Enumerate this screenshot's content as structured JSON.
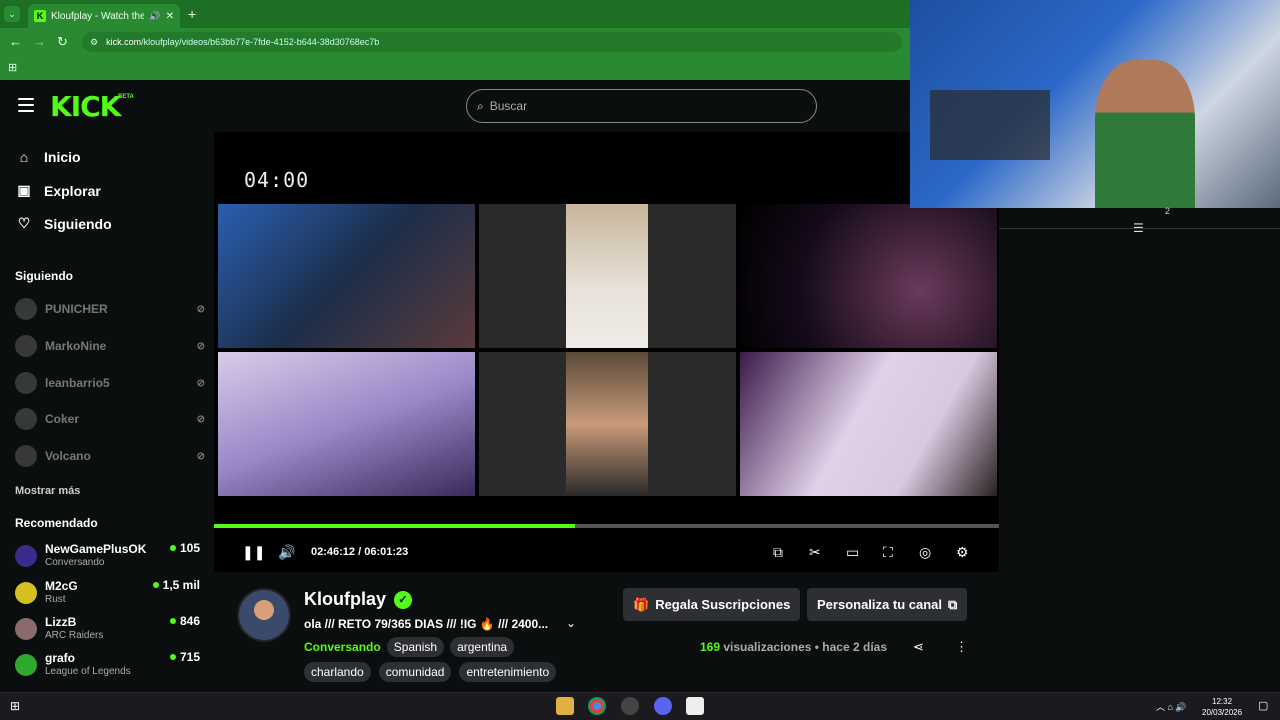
{
  "browser": {
    "tab_title": "Kloufplay - Watch the VOD",
    "url_domain": "kick.com",
    "url_path": "/kloufplay/videos/b63bb77e-7fde-4152-b644-38d30768ec7b"
  },
  "header": {
    "logo": "KICK",
    "beta": "BETA",
    "search_placeholder": "Buscar"
  },
  "sidebar": {
    "nav": [
      {
        "label": "Inicio",
        "icon": "home-icon"
      },
      {
        "label": "Explorar",
        "icon": "compass-icon"
      },
      {
        "label": "Siguiendo",
        "icon": "heart-icon"
      }
    ],
    "following_title": "Siguiendo",
    "following": [
      "PUNICHER",
      "MarkoNine",
      "leanbarrio5",
      "Coker",
      "Volcano"
    ],
    "more_label": "Mostrar más",
    "recommended_title": "Recomendado",
    "recommended": [
      {
        "name": "NewGamePlusOK",
        "category": "Conversando",
        "viewers": "105",
        "color": "#3a2a8a"
      },
      {
        "name": "M2cG",
        "category": "Rust",
        "viewers": "1,5 mil",
        "color": "#d4c020"
      },
      {
        "name": "LizzB",
        "category": "ARC Raiders",
        "viewers": "846",
        "color": "#8a6a6a"
      },
      {
        "name": "grafo",
        "category": "League of Legends",
        "viewers": "715",
        "color": "#2fa82f"
      }
    ]
  },
  "player": {
    "overlay_timer": "04:00",
    "current_time": "02:46:12",
    "duration": "06:01:23",
    "progress_fraction": 0.46
  },
  "channel": {
    "name": "Kloufplay",
    "stream_title": "ola /// RETO 79/365 DIAS /// !IG 🔥 /// 2400...",
    "category": "Conversando",
    "tags_row1": [
      "Spanish",
      "argentina"
    ],
    "tags_row2": [
      "charlando",
      "comunidad",
      "entretenimiento"
    ],
    "gift_button": "Regala Suscripciones",
    "customize_button": "Personaliza tu canal",
    "views_count": "169",
    "views_label": "visualizaciones",
    "ago": "hace 2 días"
  },
  "webcam_badge": "2",
  "taskbar": {
    "time": "12:32",
    "date": "20/03/2026"
  }
}
